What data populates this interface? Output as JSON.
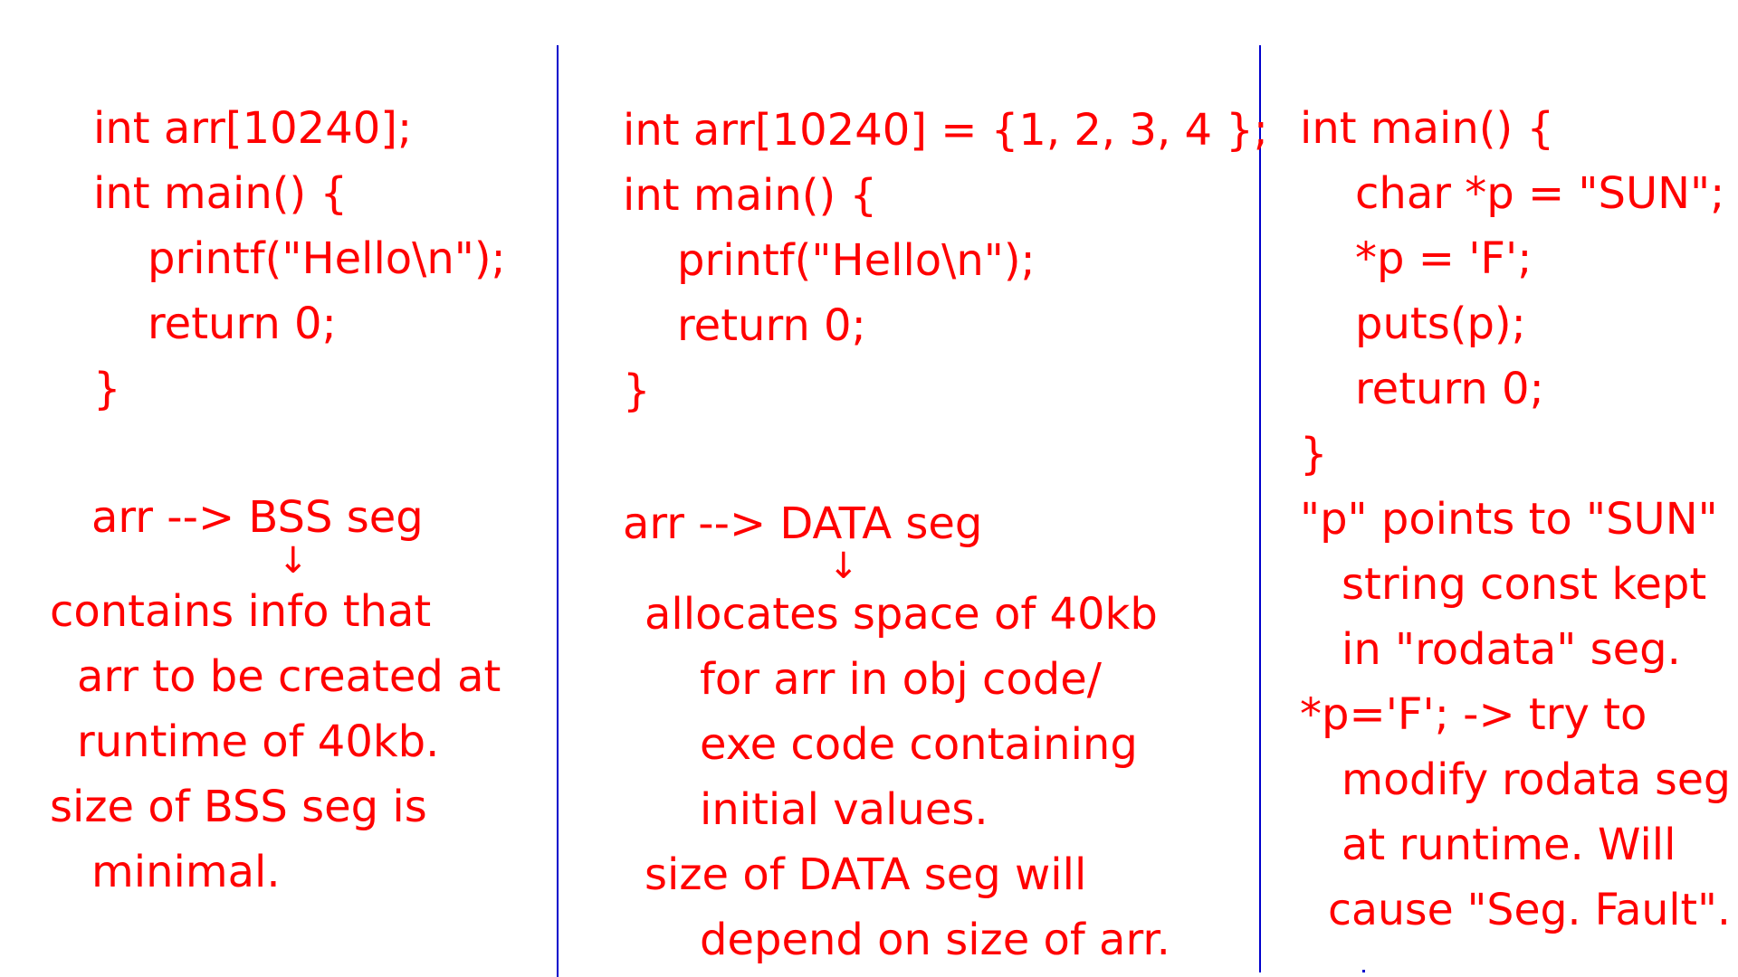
{
  "col1": {
    "code": [
      "int arr[10240];",
      "int main() {",
      "printf(\"Hello\\n\");",
      "return 0;",
      "}"
    ],
    "notes": [
      "arr --> BSS seg",
      "contains info that",
      "arr to be created at",
      "runtime of 40kb.",
      "size of BSS seg is",
      "minimal."
    ]
  },
  "col2": {
    "code": [
      "int arr[10240] = {1, 2, 3, 4 };",
      "int main() {",
      "printf(\"Hello\\n\");",
      "return 0;",
      "}"
    ],
    "notes": [
      "arr --> DATA seg",
      "allocates space of 40kb",
      "for arr in obj code/",
      "exe code containing",
      "initial values.",
      "size of DATA seg will",
      "depend on size of arr."
    ]
  },
  "col3": {
    "code": [
      "int main() {",
      "char *p = \"SUN\";",
      "*p = 'F';",
      "puts(p);",
      "return 0;",
      "}"
    ],
    "notes": [
      "\"p\" points to \"SUN\"",
      "string const kept",
      "in \"rodata\" seg.",
      "*p='F'; -> try to",
      "modify rodata seg",
      "at runtime. Will",
      "cause \"Seg. Fault\"."
    ]
  },
  "arrow_glyph": "↓"
}
